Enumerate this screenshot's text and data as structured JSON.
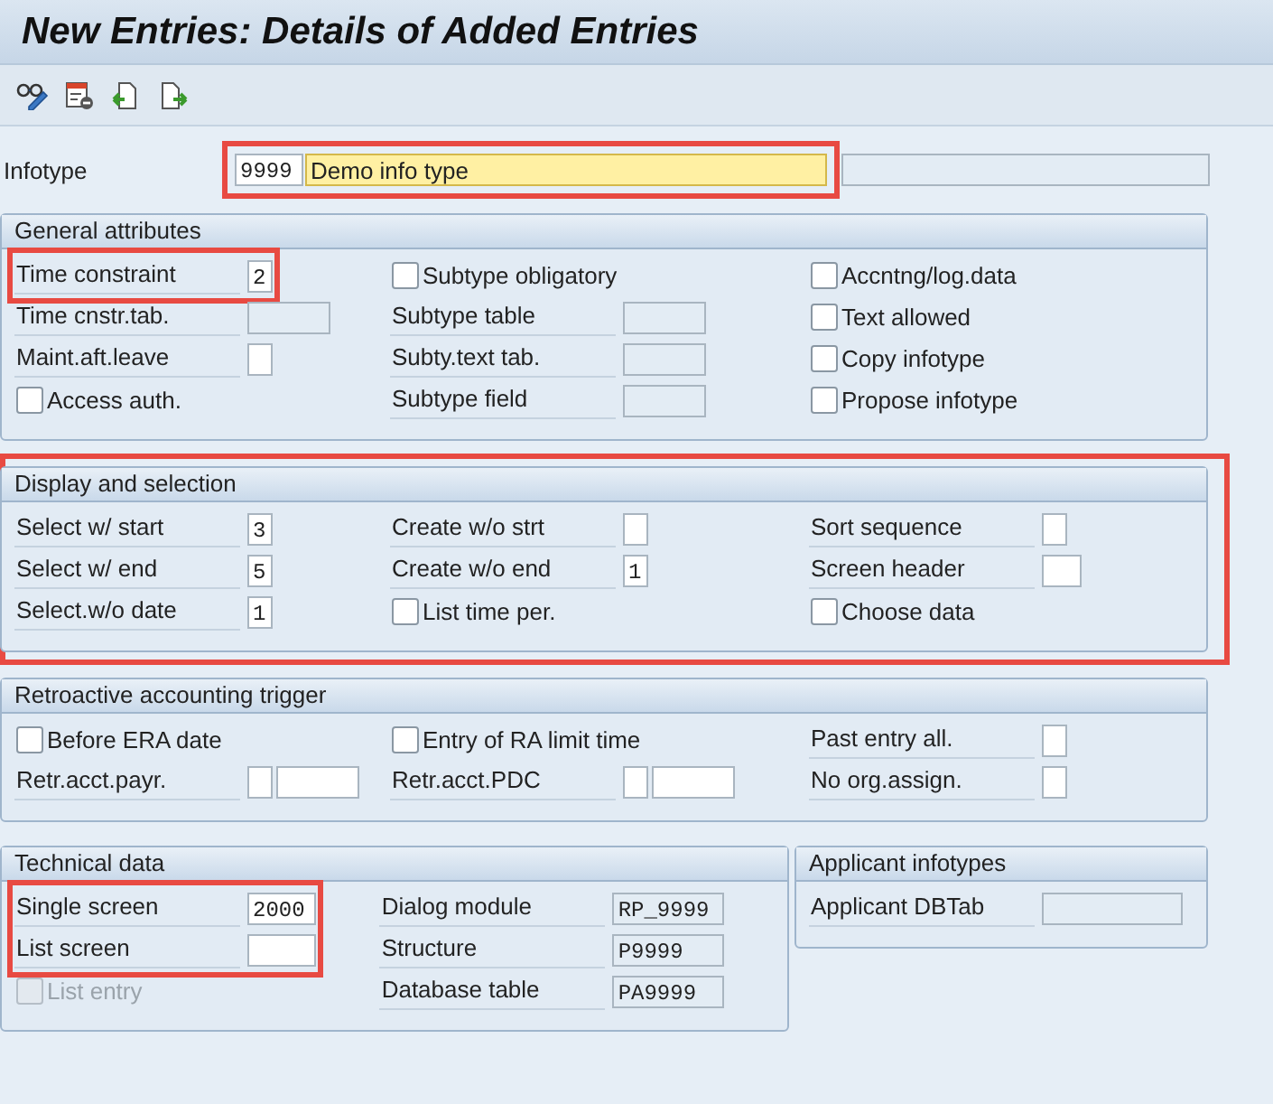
{
  "window": {
    "title": "New Entries: Details of Added Entries"
  },
  "toolbar": [
    {
      "kind": "glasses-pencil"
    },
    {
      "kind": "delete-row"
    },
    {
      "kind": "copy-left"
    },
    {
      "kind": "copy-right"
    }
  ],
  "infotype": {
    "label": "Infotype",
    "code": "9999",
    "description": "Demo info type",
    "highlighted": true
  },
  "sections": [
    {
      "title": "General attributes",
      "highlighted": false,
      "columns": [
        [
          {
            "highlighted": true,
            "items": [
              {
                "kind": "field",
                "label": "Time constraint",
                "inputs": [
                  {
                    "value": "2",
                    "kind": "tiny",
                    "editable": true
                  }
                ]
              }
            ]
          },
          {
            "highlighted": false,
            "items": [
              {
                "kind": "field",
                "label": "Time cnstr.tab.",
                "inputs": [
                  {
                    "kind": "long",
                    "editable": false
                  }
                ]
              },
              {
                "kind": "field",
                "label": "Maint.aft.leave",
                "inputs": [
                  {
                    "kind": "tiny",
                    "editable": true
                  }
                ]
              },
              {
                "kind": "checkbox",
                "label": "Access auth.",
                "checked": false,
                "disabled": false
              }
            ]
          }
        ],
        [
          {
            "highlighted": false,
            "items": [
              {
                "kind": "checkbox",
                "label": "Subtype obligatory",
                "checked": false,
                "disabled": false
              },
              {
                "kind": "field",
                "label": "Subtype table",
                "inputs": [
                  {
                    "kind": "long",
                    "editable": false
                  }
                ]
              },
              {
                "kind": "field",
                "label": "Subty.text tab.",
                "inputs": [
                  {
                    "kind": "long",
                    "editable": false
                  }
                ]
              },
              {
                "kind": "field",
                "label": "Subtype field",
                "inputs": [
                  {
                    "kind": "long",
                    "editable": false
                  }
                ]
              }
            ]
          }
        ],
        [
          {
            "highlighted": false,
            "items": [
              {
                "kind": "checkbox",
                "label": "Accntng/log.data",
                "checked": false,
                "disabled": false
              },
              {
                "kind": "checkbox",
                "label": "Text allowed",
                "checked": false,
                "disabled": false
              },
              {
                "kind": "checkbox",
                "label": "Copy infotype",
                "checked": false,
                "disabled": false
              },
              {
                "kind": "checkbox",
                "label": "Propose infotype",
                "checked": false,
                "disabled": false
              }
            ]
          }
        ]
      ]
    },
    {
      "title": "Display and selection",
      "highlighted": true,
      "columns": [
        [
          {
            "highlighted": false,
            "items": [
              {
                "kind": "field",
                "label": "Select w/ start",
                "inputs": [
                  {
                    "value": "3",
                    "kind": "tiny",
                    "editable": true
                  }
                ]
              },
              {
                "kind": "field",
                "label": "Select w/ end",
                "inputs": [
                  {
                    "value": "5",
                    "kind": "tiny",
                    "editable": true
                  }
                ]
              },
              {
                "kind": "field",
                "label": "Select.w/o date",
                "inputs": [
                  {
                    "value": "1",
                    "kind": "tiny",
                    "editable": true
                  }
                ]
              }
            ]
          }
        ],
        [
          {
            "highlighted": false,
            "items": [
              {
                "kind": "field",
                "label": "Create w/o strt",
                "inputs": [
                  {
                    "kind": "tiny",
                    "editable": true
                  }
                ]
              },
              {
                "kind": "field",
                "label": "Create w/o end",
                "inputs": [
                  {
                    "value": "1",
                    "kind": "tiny",
                    "editable": true
                  }
                ]
              },
              {
                "kind": "checkbox",
                "label": "List time per.",
                "checked": false,
                "disabled": false
              }
            ]
          }
        ],
        [
          {
            "highlighted": false,
            "items": [
              {
                "kind": "field",
                "label": "Sort sequence",
                "inputs": [
                  {
                    "kind": "tiny",
                    "editable": true
                  }
                ]
              },
              {
                "kind": "field",
                "label": "Screen header",
                "inputs": [
                  {
                    "kind": "small",
                    "editable": true
                  }
                ]
              },
              {
                "kind": "checkbox",
                "label": "Choose data",
                "checked": false,
                "disabled": false
              }
            ]
          }
        ]
      ]
    },
    {
      "title": "Retroactive accounting trigger",
      "highlighted": false,
      "columns": [
        [
          {
            "highlighted": false,
            "items": [
              {
                "kind": "checkbox",
                "label": "Before ERA date",
                "checked": false,
                "disabled": false
              },
              {
                "kind": "field",
                "label": "Retr.acct.payr.",
                "inputs": [
                  {
                    "kind": "tiny",
                    "editable": true
                  },
                  {
                    "kind": "long",
                    "editable": true
                  }
                ]
              }
            ]
          }
        ],
        [
          {
            "highlighted": false,
            "items": [
              {
                "kind": "checkbox",
                "label": "Entry of RA limit time",
                "checked": false,
                "disabled": false
              },
              {
                "kind": "field",
                "label": "Retr.acct.PDC",
                "inputs": [
                  {
                    "kind": "tiny",
                    "editable": true
                  },
                  {
                    "kind": "long",
                    "editable": true
                  }
                ]
              }
            ]
          }
        ],
        [
          {
            "highlighted": false,
            "items": [
              {
                "kind": "field",
                "label": "Past entry all.",
                "inputs": [
                  {
                    "kind": "tiny",
                    "editable": true
                  }
                ]
              },
              {
                "kind": "field",
                "label": "No org.assign.",
                "inputs": [
                  {
                    "kind": "tiny",
                    "editable": true
                  }
                ]
              }
            ]
          }
        ]
      ]
    }
  ],
  "bottom_sections": [
    {
      "title": "Technical data",
      "highlighted": false,
      "columns": [
        [
          {
            "highlighted": true,
            "items": [
              {
                "kind": "field",
                "label": "Single screen",
                "inputs": [
                  {
                    "value": "2000",
                    "kind": "medium",
                    "editable": true
                  }
                ]
              },
              {
                "kind": "field",
                "label": "List screen",
                "inputs": [
                  {
                    "kind": "medium",
                    "editable": true
                  }
                ]
              }
            ]
          },
          {
            "highlighted": false,
            "items": [
              {
                "kind": "checkbox",
                "label": "List entry",
                "checked": false,
                "disabled": true
              }
            ]
          }
        ],
        [
          {
            "highlighted": false,
            "items": [
              {
                "kind": "field",
                "label": "Dialog module",
                "inputs": [
                  {
                    "value": "RP_9999",
                    "kind": "wider",
                    "editable": false
                  }
                ]
              },
              {
                "kind": "field",
                "label": "Structure",
                "inputs": [
                  {
                    "value": "P9999",
                    "kind": "wider",
                    "editable": false
                  }
                ]
              },
              {
                "kind": "field",
                "label": "Database table",
                "inputs": [
                  {
                    "value": "PA9999",
                    "kind": "wider",
                    "editable": false
                  }
                ]
              }
            ]
          }
        ]
      ]
    },
    {
      "title": "Applicant infotypes",
      "highlighted": false,
      "columns": [
        [
          {
            "highlighted": false,
            "items": [
              {
                "kind": "field",
                "label": "Applicant DBTab",
                "inputs": [
                  {
                    "kind": "widest",
                    "editable": false
                  }
                ]
              }
            ]
          }
        ]
      ]
    }
  ]
}
